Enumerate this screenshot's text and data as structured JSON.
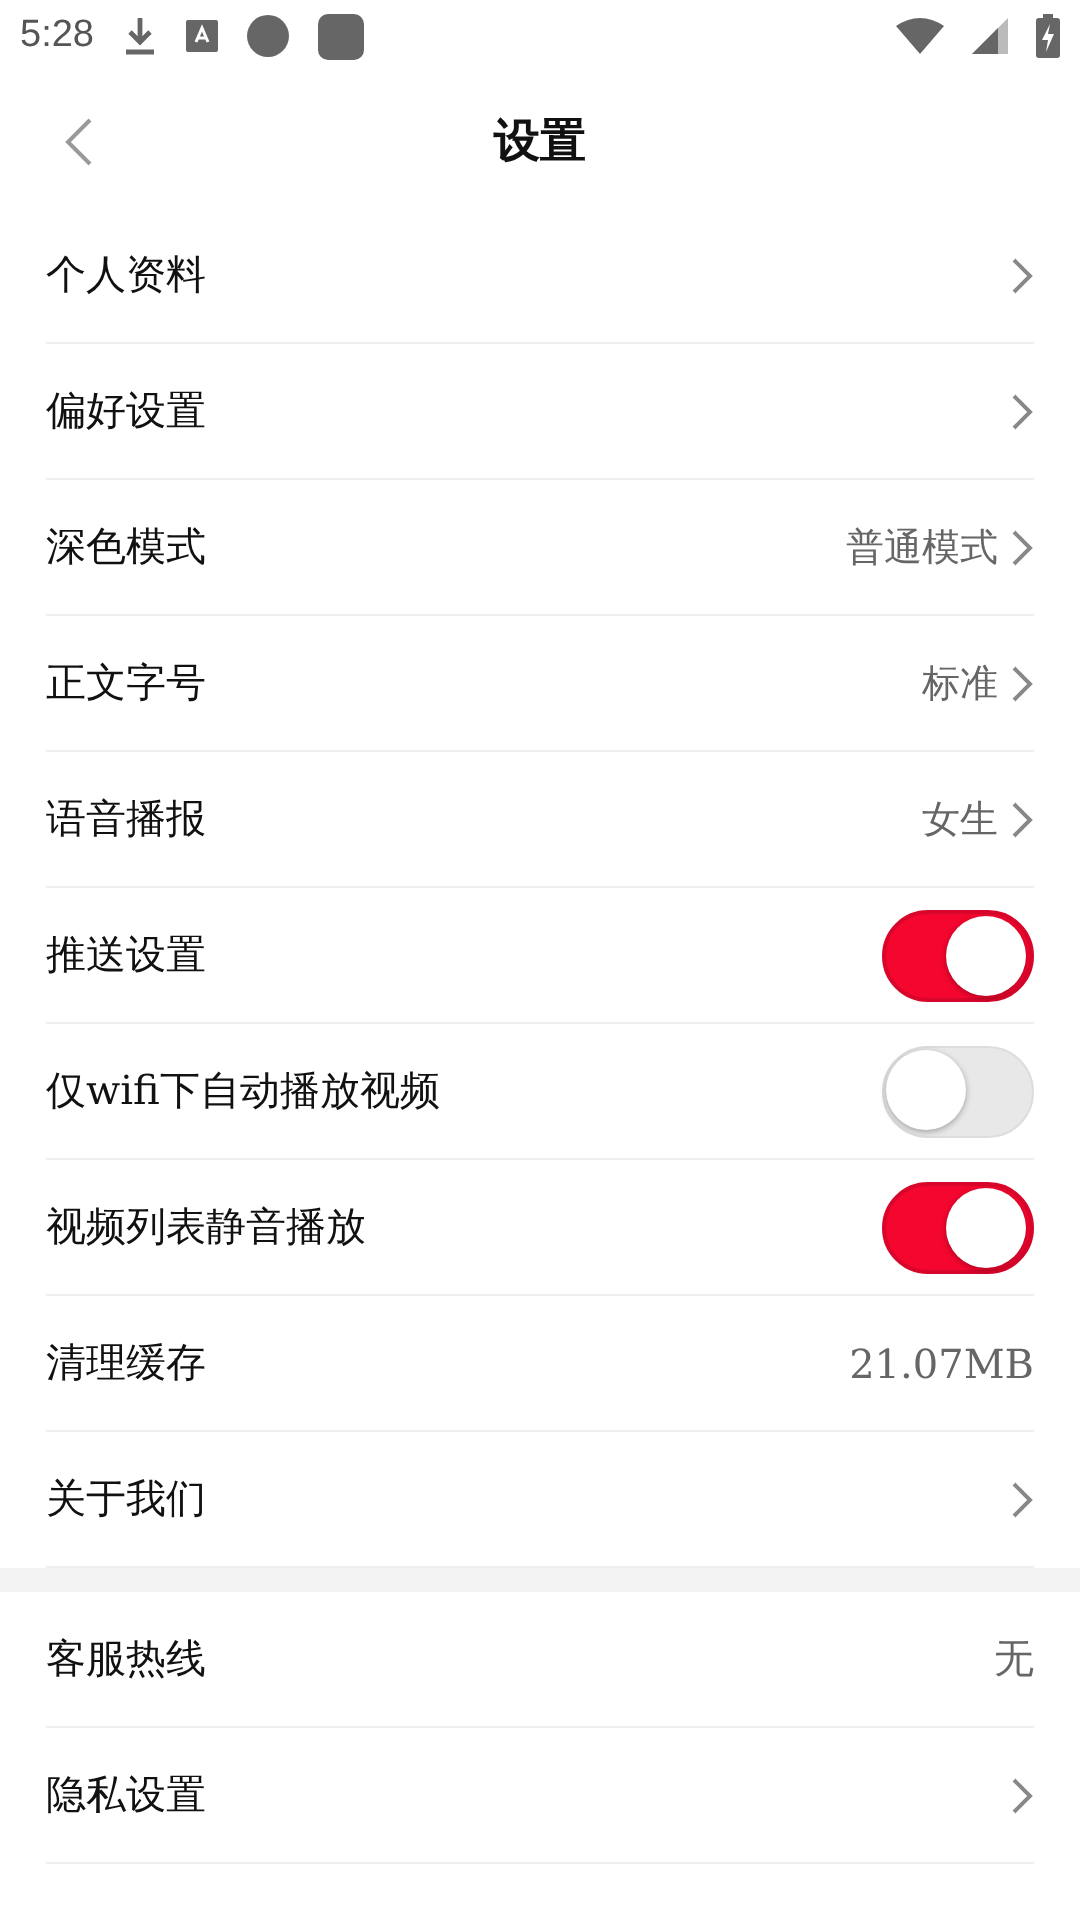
{
  "status_bar": {
    "time": "5:28"
  },
  "header": {
    "title": "设置"
  },
  "sections": [
    {
      "rows": [
        {
          "kind": "link",
          "label": "个人资料"
        },
        {
          "kind": "link",
          "label": "偏好设置"
        },
        {
          "kind": "link",
          "label": "深色模式",
          "value": "普通模式"
        },
        {
          "kind": "link",
          "label": "正文字号",
          "value": "标准"
        },
        {
          "kind": "link",
          "label": "语音播报",
          "value": "女生"
        },
        {
          "kind": "toggle",
          "label": "推送设置",
          "on": true
        },
        {
          "kind": "toggle",
          "label": "仅wifi下自动播放视频",
          "on": false
        },
        {
          "kind": "toggle",
          "label": "视频列表静音播放",
          "on": true
        },
        {
          "kind": "value",
          "label": "清理缓存",
          "value": "21.07MB"
        },
        {
          "kind": "link",
          "label": "关于我们"
        }
      ]
    },
    {
      "rows": [
        {
          "kind": "value",
          "label": "客服热线",
          "value": "无"
        },
        {
          "kind": "link",
          "label": "隐私设置"
        }
      ]
    }
  ]
}
